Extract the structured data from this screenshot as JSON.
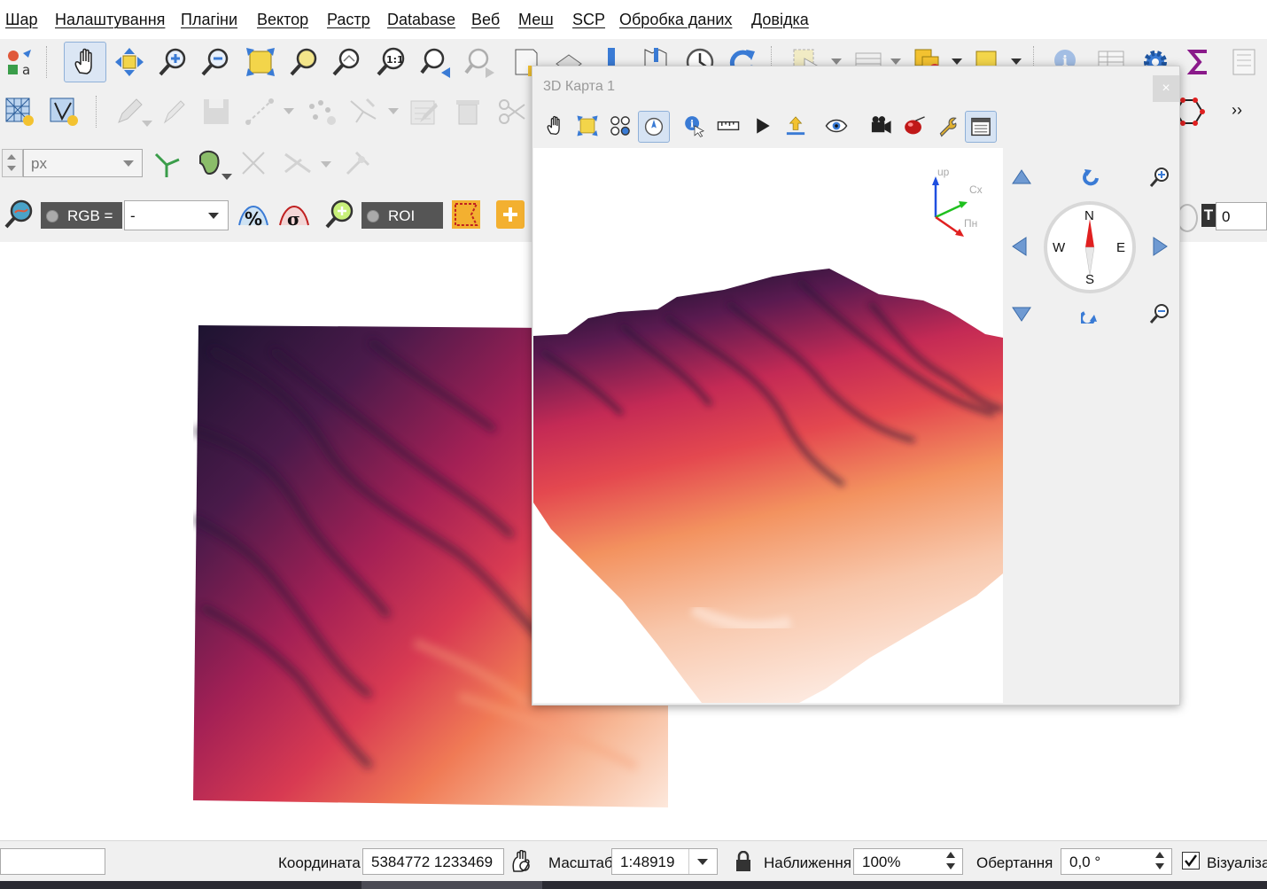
{
  "menu": {
    "items": [
      "Шар",
      "Налаштування",
      "Плагіни",
      "Вектор",
      "Растр",
      "Database",
      "Веб",
      "Меш",
      "SCP",
      "Обробка даних",
      "Довідка"
    ]
  },
  "digitize": {
    "unit": "px"
  },
  "scp": {
    "rgb_label": "RGB =",
    "rgb_value": "-",
    "roi_label": "ROI",
    "t_label": "T",
    "t_value": "0"
  },
  "window3d": {
    "title": "3D Карта 1",
    "close": "×",
    "axes": {
      "up": "up",
      "east": "Сх",
      "north": "Пн"
    },
    "compass": {
      "n": "N",
      "s": "S",
      "e": "E",
      "w": "W"
    }
  },
  "toolbar": {
    "overflow": "››"
  },
  "status": {
    "coord_label": "Координата",
    "coord_value": "5384772  1233469",
    "scale_label": "Масштаб",
    "scale_value": "1:48919",
    "zoom_label": "Наближення",
    "zoom_value": "100%",
    "rotation_label": "Обертання",
    "rotation_value": "0,0 °",
    "render_label": "Візуалізац"
  },
  "colors": {
    "accent_blue": "#3a7bd5",
    "sigma": "#8a1a8a",
    "dem_low": "#fbe3d3",
    "dem_mid": "#d23a55",
    "dem_high": "#1c1330"
  }
}
